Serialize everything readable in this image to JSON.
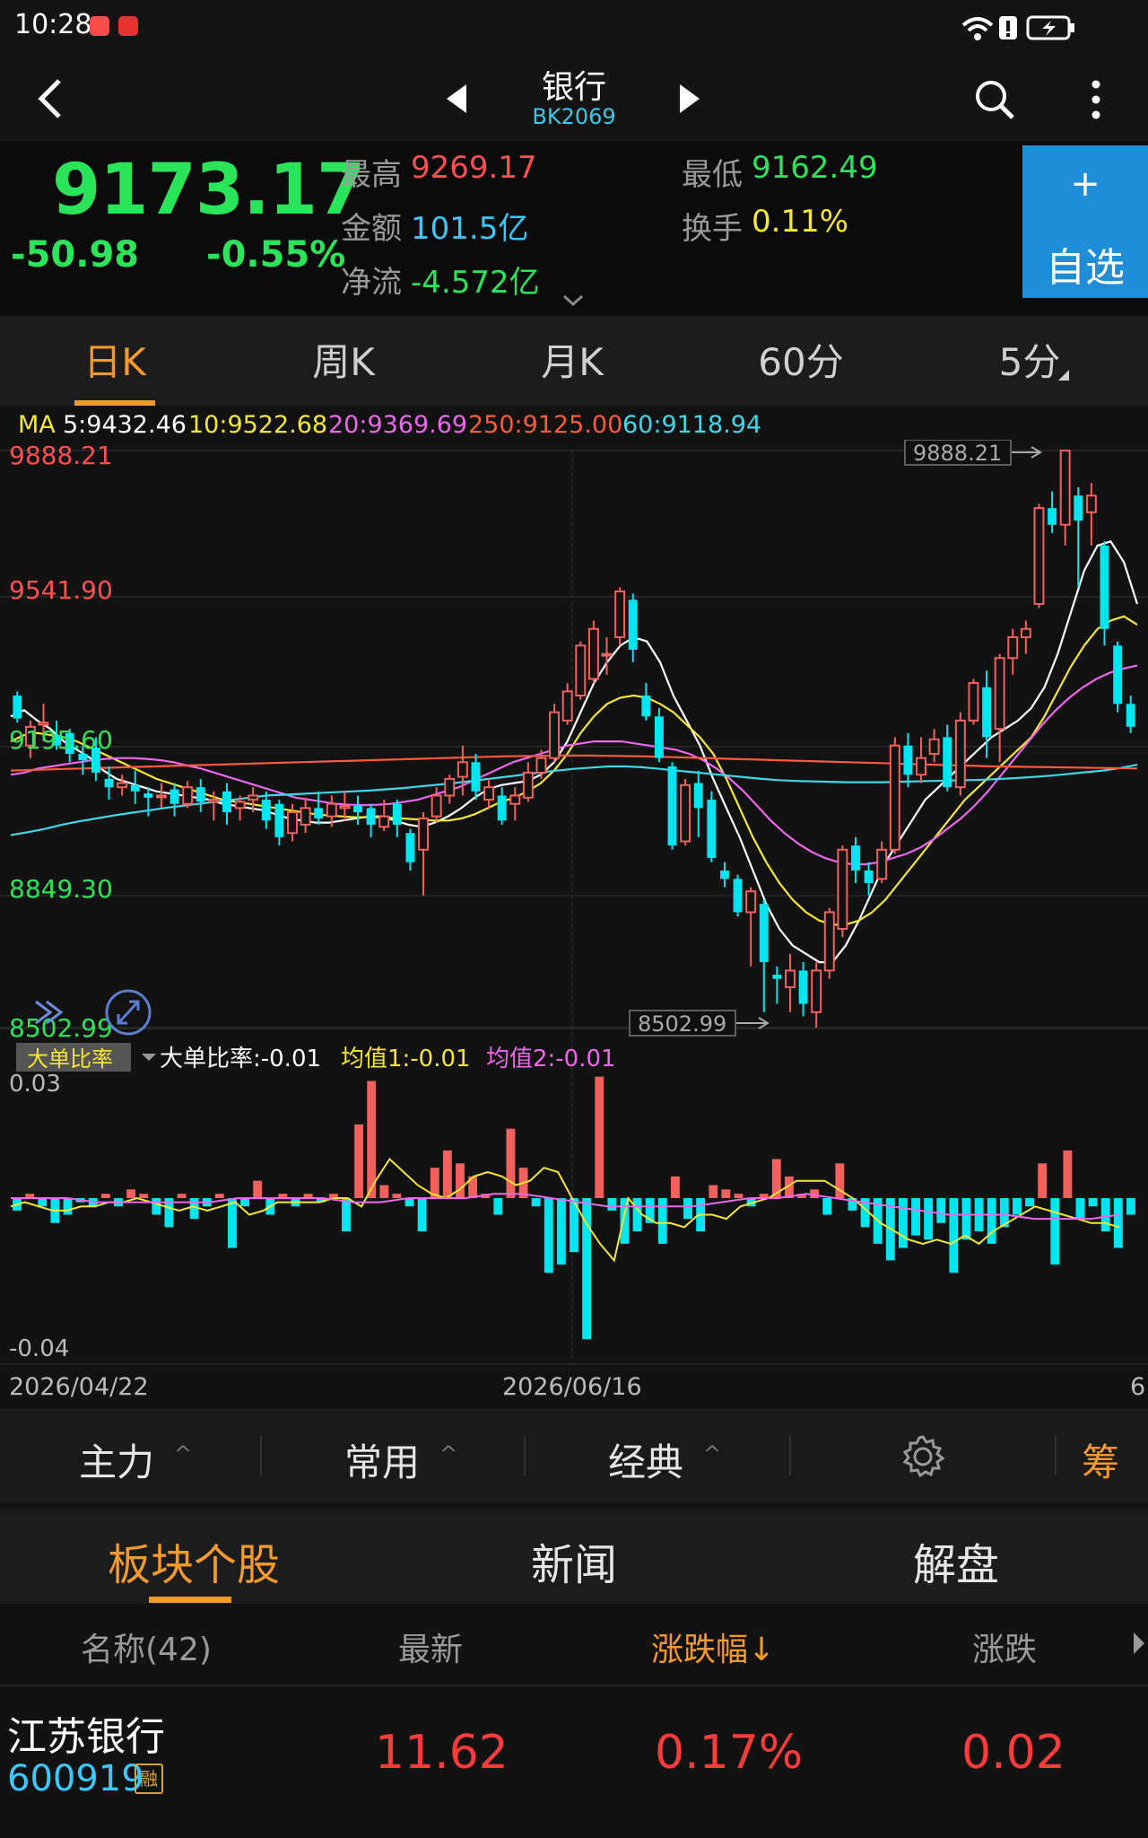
{
  "status": {
    "time": "10:28"
  },
  "nav": {
    "title": "银行",
    "code": "BK2069"
  },
  "quote": {
    "price": "9173.17",
    "change": "-50.98",
    "change_pct": "-0.55%",
    "high_label": "最高",
    "high": "9269.17",
    "low_label": "最低",
    "low": "9162.49",
    "amount_label": "金额",
    "amount": "101.5亿",
    "turnover_label": "换手",
    "turnover": "0.11%",
    "netflow_label": "净流",
    "netflow": "-4.572亿"
  },
  "fav": {
    "plus": "+",
    "label": "自选"
  },
  "periods": [
    "日K",
    "周K",
    "月K",
    "60分",
    "5分"
  ],
  "active_period": "日K",
  "ma_legend": {
    "prefix": "MA",
    "ma5": "5:9432.46",
    "ma10": "10:9522.68",
    "ma20": "20:9369.69",
    "ma250": "250:9125.00",
    "ma60": "60:9118.94"
  },
  "price_axis": {
    "top": "9888.21",
    "upper": "9541.90",
    "mid": "9195.60",
    "lower": "8849.30",
    "bottom": "8502.99"
  },
  "price_markers": {
    "high": "9888.21",
    "low": "8502.99"
  },
  "indicator": {
    "name": "大单比率",
    "value_text": "大单比率:-0.01",
    "avg1_text": "均值1:-0.01",
    "avg2_text": "均值2:-0.01",
    "axis_top": "0.03",
    "axis_bottom": "-0.04"
  },
  "dates": {
    "left": "2026/04/22",
    "mid": "2026/06/16",
    "right": "6"
  },
  "indicator_bar": {
    "main": "主力",
    "common": "常用",
    "classic": "经典",
    "chip": "筹"
  },
  "bottom_tabs": {
    "stocks": "板块个股",
    "news": "新闻",
    "analysis": "解盘"
  },
  "table": {
    "headers": {
      "name": "名称(42)",
      "latest": "最新",
      "pct": "涨跌幅↓",
      "chg": "涨跌"
    },
    "rows": [
      {
        "name": "江苏银行",
        "code": "600919",
        "tag": "融",
        "latest": "11.62",
        "pct": "0.17%",
        "chg": "0.02"
      }
    ]
  },
  "colors": {
    "up": "#ff4f4f",
    "down": "#2ae55a",
    "accent": "#f39a2d",
    "cyan": "#39c8ff"
  },
  "chart_data": {
    "type": "candlestick",
    "price_range": [
      8502.99,
      9888.21
    ],
    "candles": [
      {
        "o": 9300,
        "c": 9245,
        "h": 9310,
        "l": 9235
      },
      {
        "o": 9180,
        "c": 9225,
        "h": 9240,
        "l": 9150
      },
      {
        "o": 9230,
        "c": 9235,
        "h": 9280,
        "l": 9190
      },
      {
        "o": 9205,
        "c": 9180,
        "h": 9240,
        "l": 9170
      },
      {
        "o": 9210,
        "c": 9160,
        "h": 9220,
        "l": 9140
      },
      {
        "o": 9160,
        "c": 9145,
        "h": 9180,
        "l": 9110
      },
      {
        "o": 9175,
        "c": 9115,
        "h": 9200,
        "l": 9095
      },
      {
        "o": 9100,
        "c": 9080,
        "h": 9130,
        "l": 9050
      },
      {
        "o": 9080,
        "c": 9090,
        "h": 9110,
        "l": 9060
      },
      {
        "o": 9085,
        "c": 9070,
        "h": 9120,
        "l": 9040
      },
      {
        "o": 9065,
        "c": 9055,
        "h": 9080,
        "l": 9010
      },
      {
        "o": 9060,
        "c": 9060,
        "h": 9090,
        "l": 9030
      },
      {
        "o": 9075,
        "c": 9040,
        "h": 9090,
        "l": 9010
      },
      {
        "o": 9040,
        "c": 9080,
        "h": 9095,
        "l": 9030
      },
      {
        "o": 9080,
        "c": 9045,
        "h": 9100,
        "l": 9020
      },
      {
        "o": 9045,
        "c": 9050,
        "h": 9070,
        "l": 9000
      },
      {
        "o": 9070,
        "c": 9020,
        "h": 9090,
        "l": 8990
      },
      {
        "o": 9030,
        "c": 9045,
        "h": 9060,
        "l": 9000
      },
      {
        "o": 9050,
        "c": 9060,
        "h": 9080,
        "l": 9020
      },
      {
        "o": 9050,
        "c": 9000,
        "h": 9070,
        "l": 8980
      },
      {
        "o": 9040,
        "c": 8960,
        "h": 9050,
        "l": 8940
      },
      {
        "o": 8970,
        "c": 9020,
        "h": 9040,
        "l": 8950
      },
      {
        "o": 8990,
        "c": 9030,
        "h": 9055,
        "l": 8970
      },
      {
        "o": 9030,
        "c": 9005,
        "h": 9070,
        "l": 8990
      },
      {
        "o": 9010,
        "c": 9040,
        "h": 9060,
        "l": 8985
      },
      {
        "o": 9030,
        "c": 9035,
        "h": 9070,
        "l": 9000
      },
      {
        "o": 9035,
        "c": 9020,
        "h": 9060,
        "l": 8990
      },
      {
        "o": 9030,
        "c": 8990,
        "h": 9040,
        "l": 8960
      },
      {
        "o": 8985,
        "c": 9010,
        "h": 9050,
        "l": 8975
      },
      {
        "o": 9040,
        "c": 8990,
        "h": 9050,
        "l": 8960
      },
      {
        "o": 8970,
        "c": 8900,
        "h": 8980,
        "l": 8880
      },
      {
        "o": 8930,
        "c": 9005,
        "h": 9020,
        "l": 8820
      },
      {
        "o": 9010,
        "c": 9060,
        "h": 9080,
        "l": 8995
      },
      {
        "o": 9060,
        "c": 9100,
        "h": 9110,
        "l": 9040
      },
      {
        "o": 9105,
        "c": 9140,
        "h": 9180,
        "l": 9060
      },
      {
        "o": 9140,
        "c": 9070,
        "h": 9160,
        "l": 9050
      },
      {
        "o": 9050,
        "c": 9080,
        "h": 9100,
        "l": 9030
      },
      {
        "o": 9060,
        "c": 9000,
        "h": 9080,
        "l": 8990
      },
      {
        "o": 9040,
        "c": 9060,
        "h": 9080,
        "l": 9000
      },
      {
        "o": 9055,
        "c": 9115,
        "h": 9140,
        "l": 9045
      },
      {
        "o": 9115,
        "c": 9150,
        "h": 9170,
        "l": 9100
      },
      {
        "o": 9150,
        "c": 9260,
        "h": 9280,
        "l": 9140
      },
      {
        "o": 9240,
        "c": 9310,
        "h": 9330,
        "l": 9230
      },
      {
        "o": 9300,
        "c": 9420,
        "h": 9430,
        "l": 9290
      },
      {
        "o": 9340,
        "c": 9460,
        "h": 9480,
        "l": 9330
      },
      {
        "o": 9400,
        "c": 9400,
        "h": 9440,
        "l": 9350
      },
      {
        "o": 9440,
        "c": 9550,
        "h": 9560,
        "l": 9420
      },
      {
        "o": 9530,
        "c": 9410,
        "h": 9545,
        "l": 9380
      },
      {
        "o": 9300,
        "c": 9250,
        "h": 9330,
        "l": 9240
      },
      {
        "o": 9250,
        "c": 9150,
        "h": 9270,
        "l": 9140
      },
      {
        "o": 9130,
        "c": 8940,
        "h": 9140,
        "l": 8930
      },
      {
        "o": 8950,
        "c": 9085,
        "h": 9100,
        "l": 8940
      },
      {
        "o": 9090,
        "c": 9030,
        "h": 9120,
        "l": 8960
      },
      {
        "o": 9050,
        "c": 8910,
        "h": 9070,
        "l": 8900
      },
      {
        "o": 8880,
        "c": 8860,
        "h": 8900,
        "l": 8840
      },
      {
        "o": 8860,
        "c": 8780,
        "h": 8870,
        "l": 8770
      },
      {
        "o": 8780,
        "c": 8830,
        "h": 8840,
        "l": 8650
      },
      {
        "o": 8800,
        "c": 8660,
        "h": 8810,
        "l": 8540
      },
      {
        "o": 8630,
        "c": 8620,
        "h": 8650,
        "l": 8560
      },
      {
        "o": 8600,
        "c": 8640,
        "h": 8680,
        "l": 8540
      },
      {
        "o": 8640,
        "c": 8560,
        "h": 8660,
        "l": 8530
      },
      {
        "o": 8540,
        "c": 8640,
        "h": 8660,
        "l": 8503
      },
      {
        "o": 8640,
        "c": 8780,
        "h": 8790,
        "l": 8620
      },
      {
        "o": 8740,
        "c": 8930,
        "h": 8940,
        "l": 8720
      },
      {
        "o": 8940,
        "c": 8880,
        "h": 8960,
        "l": 8850
      },
      {
        "o": 8880,
        "c": 8850,
        "h": 8900,
        "l": 8820
      },
      {
        "o": 8860,
        "c": 8930,
        "h": 8950,
        "l": 8850
      },
      {
        "o": 8930,
        "c": 9180,
        "h": 9200,
        "l": 8920
      },
      {
        "o": 9180,
        "c": 9110,
        "h": 9210,
        "l": 9080
      },
      {
        "o": 9110,
        "c": 9150,
        "h": 9200,
        "l": 9090
      },
      {
        "o": 9160,
        "c": 9195,
        "h": 9220,
        "l": 9140
      },
      {
        "o": 9200,
        "c": 9080,
        "h": 9230,
        "l": 9070
      },
      {
        "o": 9080,
        "c": 9240,
        "h": 9260,
        "l": 9060
      },
      {
        "o": 9240,
        "c": 9330,
        "h": 9340,
        "l": 9230
      },
      {
        "o": 9320,
        "c": 9200,
        "h": 9360,
        "l": 9150
      },
      {
        "o": 9220,
        "c": 9390,
        "h": 9400,
        "l": 9140
      },
      {
        "o": 9390,
        "c": 9440,
        "h": 9460,
        "l": 9350
      },
      {
        "o": 9440,
        "c": 9460,
        "h": 9480,
        "l": 9400
      },
      {
        "o": 9520,
        "c": 9750,
        "h": 9760,
        "l": 9510
      },
      {
        "o": 9750,
        "c": 9710,
        "h": 9790,
        "l": 9690
      },
      {
        "o": 9710,
        "c": 9888,
        "h": 9888,
        "l": 9660
      },
      {
        "o": 9780,
        "c": 9720,
        "h": 9800,
        "l": 9560
      },
      {
        "o": 9740,
        "c": 9780,
        "h": 9810,
        "l": 9660
      },
      {
        "o": 9660,
        "c": 9460,
        "h": 9670,
        "l": 9420
      },
      {
        "o": 9420,
        "c": 9280,
        "h": 9430,
        "l": 9260
      },
      {
        "o": 9280,
        "c": 9225,
        "h": 9300,
        "l": 9210
      }
    ],
    "ma": [
      {
        "name": "MA5",
        "color": "#ffffff",
        "values": [
          9250,
          9265,
          9240,
          9220,
          9190,
          9170,
          9150,
          9120,
          9100,
          9090,
          9080,
          9070,
          9065,
          9060,
          9055,
          9050,
          9040,
          9035,
          9030,
          9025,
          9015,
          9005,
          9000,
          8995,
          8995,
          9000,
          9005,
          9010,
          9010,
          9000,
          8990,
          8985,
          8995,
          9010,
          9030,
          9055,
          9075,
          9085,
          9090,
          9095,
          9110,
          9140,
          9190,
          9260,
          9330,
          9380,
          9420,
          9440,
          9430,
          9380,
          9300,
          9240,
          9180,
          9100,
          9030,
          8960,
          8880,
          8800,
          8740,
          8700,
          8680,
          8660,
          8660,
          8700,
          8760,
          8830,
          8900,
          8950,
          9000,
          9050,
          9080,
          9110,
          9140,
          9170,
          9200,
          9220,
          9240,
          9270,
          9320,
          9400,
          9500,
          9600,
          9660,
          9670,
          9620,
          9520
        ]
      },
      {
        "name": "MA10",
        "color": "#f5e733",
        "values": [
          9190,
          9205,
          9210,
          9205,
          9200,
          9190,
          9175,
          9160,
          9145,
          9130,
          9115,
          9100,
          9090,
          9080,
          9070,
          9060,
          9050,
          9045,
          9040,
          9035,
          9030,
          9025,
          9020,
          9015,
          9012,
          9010,
          9008,
          9008,
          9008,
          9006,
          9004,
          9002,
          9000,
          9000,
          9005,
          9015,
          9030,
          9045,
          9055,
          9070,
          9090,
          9120,
          9160,
          9210,
          9250,
          9280,
          9295,
          9300,
          9295,
          9280,
          9260,
          9230,
          9200,
          9160,
          9100,
          9030,
          8960,
          8900,
          8850,
          8810,
          8780,
          8760,
          8750,
          8750,
          8760,
          8780,
          8810,
          8850,
          8890,
          8930,
          8970,
          9010,
          9050,
          9080,
          9110,
          9140,
          9170,
          9200,
          9250,
          9310,
          9370,
          9420,
          9460,
          9480,
          9490,
          9470
        ]
      },
      {
        "name": "MA20",
        "color": "#ee66ee",
        "values": [
          9110,
          9115,
          9125,
          9130,
          9135,
          9140,
          9145,
          9148,
          9150,
          9150,
          9148,
          9145,
          9140,
          9132,
          9125,
          9115,
          9105,
          9095,
          9085,
          9075,
          9065,
          9055,
          9050,
          9045,
          9040,
          9038,
          9037,
          9038,
          9040,
          9045,
          9050,
          9060,
          9070,
          9080,
          9095,
          9110,
          9125,
          9140,
          9150,
          9160,
          9170,
          9180,
          9185,
          9190,
          9190,
          9190,
          9185,
          9180,
          9175,
          9170,
          9160,
          9145,
          9125,
          9100,
          9070,
          9035,
          9000,
          8970,
          8945,
          8925,
          8910,
          8900,
          8895,
          8895,
          8900,
          8910,
          8920,
          8935,
          8955,
          8980,
          9005,
          9035,
          9070,
          9110,
          9150,
          9190,
          9230,
          9265,
          9295,
          9320,
          9340,
          9355,
          9365,
          9372
        ]
      },
      {
        "name": "MA60",
        "color": "#3fd8e8",
        "values": [
          8965,
          8972,
          8980,
          8990,
          8998,
          9005,
          9012,
          9018,
          9024,
          9030,
          9035,
          9040,
          9045,
          9050,
          9055,
          9060,
          9062,
          9064,
          9066,
          9068,
          9070,
          9072,
          9075,
          9078,
          9082,
          9086,
          9090,
          9095,
          9100,
          9105,
          9110,
          9115,
          9120,
          9124,
          9127,
          9130,
          9130,
          9128,
          9124,
          9120,
          9116,
          9112,
          9108,
          9104,
          9100,
          9097,
          9095,
          9094,
          9093,
          9092,
          9092,
          9092,
          9093,
          9094,
          9095,
          9096,
          9097,
          9098,
          9100,
          9102,
          9105,
          9108,
          9112,
          9116,
          9120,
          9126,
          9134
        ]
      },
      {
        "name": "MA250",
        "color": "#ff5a3c",
        "values": [
          9120,
          9122,
          9124,
          9126,
          9128,
          9130,
          9132,
          9134,
          9136,
          9138,
          9140,
          9142,
          9144,
          9146,
          9148,
          9150,
          9152,
          9154,
          9155,
          9156,
          9156,
          9155,
          9154,
          9152,
          9150,
          9148,
          9146,
          9144,
          9142,
          9140,
          9138,
          9136,
          9134,
          9132,
          9130,
          9129,
          9128,
          9127,
          9126,
          9125
        ]
      }
    ],
    "indicator_bars": [
      -0.003,
      0.001,
      -0.002,
      -0.006,
      -0.004,
      -0.001,
      -0.002,
      0.001,
      -0.002,
      0.002,
      0.001,
      -0.004,
      -0.007,
      0.001,
      -0.005,
      -0.002,
      0.001,
      -0.012,
      -0.002,
      0.004,
      -0.004,
      0.001,
      -0.002,
      0.001,
      -0.001,
      0.001,
      -0.008,
      0.017,
      0.027,
      0.003,
      0.001,
      -0.002,
      -0.008,
      0.007,
      0.011,
      0.008,
      0.005,
      0.001,
      -0.004,
      0.016,
      0.007,
      -0.002,
      -0.018,
      -0.016,
      -0.013,
      -0.034,
      0.028,
      -0.003,
      -0.011,
      -0.008,
      -0.006,
      -0.011,
      0.005,
      -0.005,
      -0.008,
      0.003,
      0.002,
      0.001,
      -0.002,
      0.001,
      0.009,
      0.005,
      0.001,
      0.002,
      -0.004,
      0.008,
      -0.003,
      -0.007,
      -0.011,
      -0.015,
      -0.012,
      -0.009,
      -0.01,
      -0.006,
      -0.018,
      -0.01,
      -0.008,
      -0.011,
      -0.007,
      -0.004,
      -0.002,
      0.008,
      -0.016,
      0.011,
      -0.005,
      -0.002,
      -0.008,
      -0.012,
      -0.004
    ],
    "indicator_avg1": [
      -0.002,
      -0.001,
      -0.002,
      -0.003,
      -0.003,
      -0.002,
      -0.002,
      -0.001,
      -0.001,
      0.0,
      -0.001,
      -0.002,
      -0.003,
      -0.002,
      -0.003,
      -0.002,
      -0.001,
      -0.004,
      -0.003,
      -0.001,
      -0.001,
      -0.001,
      -0.001,
      0.0,
      0.0,
      -0.002,
      0.004,
      0.009,
      0.006,
      0.003,
      0.001,
      0.0,
      0.002,
      0.005,
      0.006,
      0.005,
      0.003,
      0.004,
      0.007,
      0.006,
      0.0,
      -0.006,
      -0.011,
      -0.015,
      0.0,
      -0.004,
      -0.006,
      -0.006,
      -0.007,
      -0.004,
      -0.004,
      -0.005,
      -0.002,
      -0.001,
      0.0,
      0.002,
      0.004,
      0.004,
      0.004,
      0.002,
      0.0,
      -0.003,
      -0.006,
      -0.008,
      -0.01,
      -0.011,
      -0.01,
      -0.011,
      -0.009,
      -0.011,
      -0.008,
      -0.006,
      -0.004,
      -0.002,
      -0.003,
      -0.004,
      -0.005,
      -0.006,
      -0.006,
      -0.007
    ],
    "indicator_avg2": [
      0.0,
      0.0,
      0.0,
      -0.001,
      -0.001,
      -0.001,
      -0.001,
      -0.001,
      0.0,
      0.0,
      0.0,
      0.0,
      -0.001,
      -0.001,
      0.0,
      0.0,
      0.0,
      0.001,
      0.001,
      0.0,
      -0.001,
      -0.002,
      -0.002,
      -0.002,
      -0.002,
      -0.001,
      0.0,
      0.0,
      0.001,
      0.0,
      -0.001,
      -0.002,
      -0.003,
      -0.004,
      -0.004,
      -0.004,
      -0.005,
      -0.005,
      -0.005,
      -0.004
    ]
  }
}
